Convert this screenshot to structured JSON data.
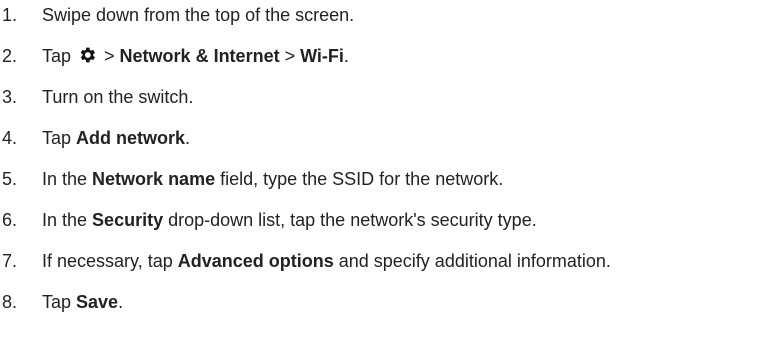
{
  "steps": [
    {
      "number": "1.",
      "parts": [
        "Swipe down from the top of the screen."
      ]
    },
    {
      "number": "2.",
      "parts": [
        "Tap ",
        "gear-icon",
        " > ",
        "Network & Internet",
        " > ",
        "Wi-Fi",
        "."
      ]
    },
    {
      "number": "3.",
      "parts": [
        "Turn on the switch."
      ]
    },
    {
      "number": "4.",
      "parts": [
        "Tap ",
        "Add network",
        "."
      ]
    },
    {
      "number": "5.",
      "parts": [
        "In the ",
        "Network name",
        " field, type the SSID for the network."
      ]
    },
    {
      "number": "6.",
      "parts": [
        "In the ",
        "Security",
        " drop-down list, tap the network's security type."
      ]
    },
    {
      "number": "7.",
      "parts": [
        "If necessary, tap ",
        "Advanced options",
        " and specify additional information."
      ]
    },
    {
      "number": "8.",
      "parts": [
        "Tap ",
        "Save",
        "."
      ]
    }
  ]
}
